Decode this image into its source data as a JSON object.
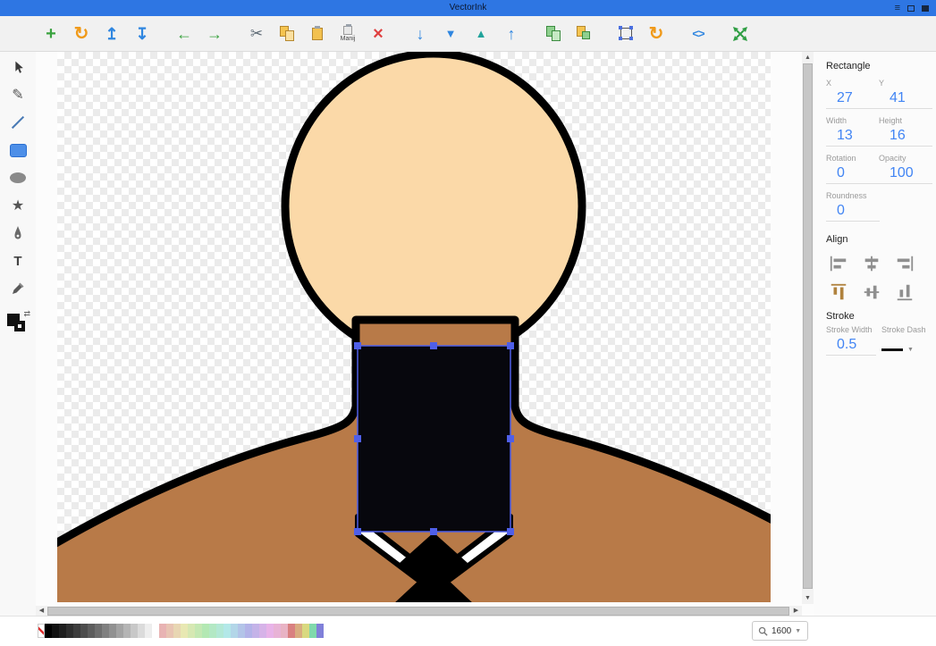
{
  "colors": {
    "titlebar": "#2e76e3",
    "accent": "#4285f4",
    "skin": "#fbd9a8",
    "shirt": "#b87a48",
    "selection": "#4f5fe8",
    "toolbar_green": "#3aa23f",
    "toolbar_orange": "#f09a1a",
    "toolbar_blue": "#2f86e0",
    "toolbar_teal": "#21a39b",
    "toolbar_red": "#df4040"
  },
  "window": {
    "title": "VectorInk",
    "menu_icon": "≡"
  },
  "toolbar": {
    "new": "+",
    "reload": "↻",
    "import": "↥",
    "export": "↧",
    "undo": "←",
    "redo": "→",
    "cut": "✂",
    "paste_special_label": "Manij",
    "delete": "×",
    "lower": "↓",
    "lower_to_bottom": "▼",
    "raise_to_top": "▲",
    "raise": "↑",
    "rotate": "↻",
    "xml": "<>"
  },
  "tools": {
    "pencil": "✎",
    "star": "★",
    "text": "T"
  },
  "panel": {
    "title": "Rectangle",
    "fields": [
      {
        "label": "X",
        "value": "27"
      },
      {
        "label": "Y",
        "value": "41"
      },
      {
        "label": "Width",
        "value": "13"
      },
      {
        "label": "Height",
        "value": "16"
      },
      {
        "label": "Rotation",
        "value": "0"
      },
      {
        "label": "Opacity",
        "value": "100"
      },
      {
        "label": "Roundness",
        "value": "0"
      }
    ],
    "align_title": "Align",
    "stroke_title": "Stroke",
    "stroke_width_label": "Stroke Width",
    "stroke_width_value": "0.5",
    "stroke_dash_label": "Stroke Dash"
  },
  "statusbar": {
    "zoom_value": "1600",
    "palette": [
      "none",
      "#000000",
      "#111111",
      "#1f1f1f",
      "#2e2e2e",
      "#3d3d3d",
      "#4d4d4d",
      "#5d5d5d",
      "#6e6e6e",
      "#808080",
      "#919191",
      "#a3a3a3",
      "#b5b5b5",
      "#c8c8c8",
      "#dbdbdb",
      "#eeeeee",
      "#ffffff",
      "#e8b3b3",
      "#e8c4b3",
      "#e8d6b3",
      "#e8e8b3",
      "#d6e8b3",
      "#c4e8b3",
      "#b3e8b3",
      "#b3e8c4",
      "#b3e8d6",
      "#b3e8e8",
      "#b3d6e8",
      "#b3c4e8",
      "#b3b3e8",
      "#c4b3e8",
      "#d6b3e8",
      "#e8b3e8",
      "#e8b3d6",
      "#e8b3c4",
      "#d98080",
      "#d9ac80",
      "#d9d980",
      "#80d9ac",
      "#8080d9"
    ]
  }
}
